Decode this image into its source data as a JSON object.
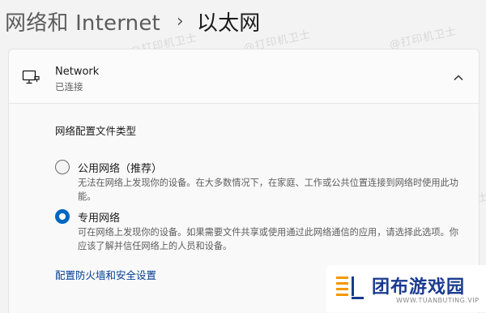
{
  "breadcrumb": {
    "parent": "网络和 Internet",
    "separator": "›",
    "current": "以太网"
  },
  "network": {
    "name": "Network",
    "status": "已连接",
    "expanded": true
  },
  "profile": {
    "title": "网络配置文件类型",
    "options": [
      {
        "label": "公用网络（推荐）",
        "description": "无法在网络上发现你的设备。在大多数情况下，在家庭、工作或公共位置连接到网络时使用此功能。",
        "selected": false
      },
      {
        "label": "专用网络",
        "description": "可在网络上发现你的设备。如果需要文件共享或使用通过此网络通信的应用，请选择此选项。你应该了解并信任网络上的人员和设备。",
        "selected": true
      }
    ],
    "firewall_link": "配置防火墙和安全设置"
  },
  "watermark": "@打印机卫士",
  "logo": {
    "text": "团布游戏园",
    "sub": "WWW.TUANBUTING.VIP"
  },
  "colors": {
    "accent": "#0067c0",
    "link": "#003e92",
    "logo_text": "#1a3a8f",
    "logo_orange": "#f39800"
  },
  "icons": {
    "network": "monitor-icon",
    "expand": "chevron-up-icon"
  }
}
